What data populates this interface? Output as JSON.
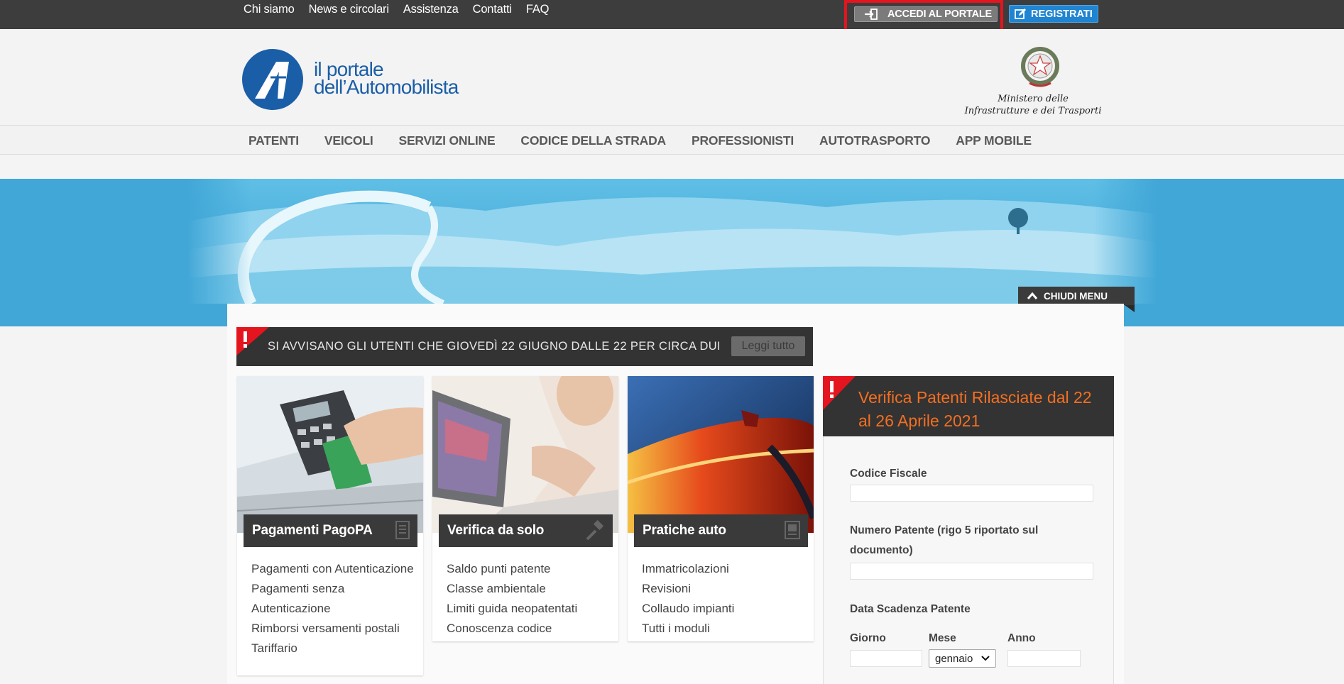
{
  "topbar": {
    "links": [
      "Chi siamo",
      "News e circolari",
      "Assistenza",
      "Contatti",
      "FAQ"
    ],
    "login_label": "ACCEDI AL PORTALE",
    "register_label": "REGISTRATI"
  },
  "header": {
    "logo_line1": "il portale",
    "logo_line2": "dell’Automobilista",
    "ministry_line1": "Ministero delle",
    "ministry_line2": "Infrastrutture e dei Trasporti"
  },
  "nav": [
    "PATENTI",
    "VEICOLI",
    "SERVIZI ONLINE",
    "CODICE DELLA STRADA",
    "PROFESSIONISTI",
    "AUTOTRASPORTO",
    "APP MOBILE"
  ],
  "hero": {
    "close_menu_label": "CHIUDI MENU"
  },
  "alert": {
    "text": "SI AVVISANO GLI UTENTI CHE GIOVEDÌ 22 GIUGNO DALLE 22 PER CIRCA DUE",
    "read_more_label": "Leggi tutto"
  },
  "cards": [
    {
      "title": "Pagamenti PagoPA",
      "icon": "document-icon",
      "items": [
        "Pagamenti con Autenticazione",
        "Pagamenti senza Autenticazione",
        "Rimborsi versamenti postali",
        "Tariffario"
      ]
    },
    {
      "title": "Verifica da solo",
      "icon": "hammer-icon",
      "items": [
        "Saldo punti patente",
        "Classe ambientale",
        "Limiti guida neopatentati",
        "Conoscenza codice"
      ]
    },
    {
      "title": "Pratiche auto",
      "icon": "form-icon",
      "items": [
        "Immatricolazioni",
        "Revisioni",
        "Collaudo impianti",
        "Tutti i moduli"
      ]
    }
  ],
  "verifica": {
    "title": "Verifica Patenti Rilasciate dal 22 al 26 Aprile 2021",
    "codice_fiscale_label": "Codice Fiscale",
    "numero_patente_label": "Numero Patente (rigo 5 riportato sul documento)",
    "data_scadenza_label": "Data Scadenza Patente",
    "giorno_label": "Giorno",
    "mese_label": "Mese",
    "mese_value": "gennaio",
    "anno_label": "Anno"
  },
  "colors": {
    "topbar": "#3d3d3d",
    "brand_blue": "#1a5ea7",
    "register_blue": "#1f84d1",
    "accent_orange": "#f36f21",
    "alert_red": "#e4151f",
    "hero_blue": "#41a7d7"
  }
}
